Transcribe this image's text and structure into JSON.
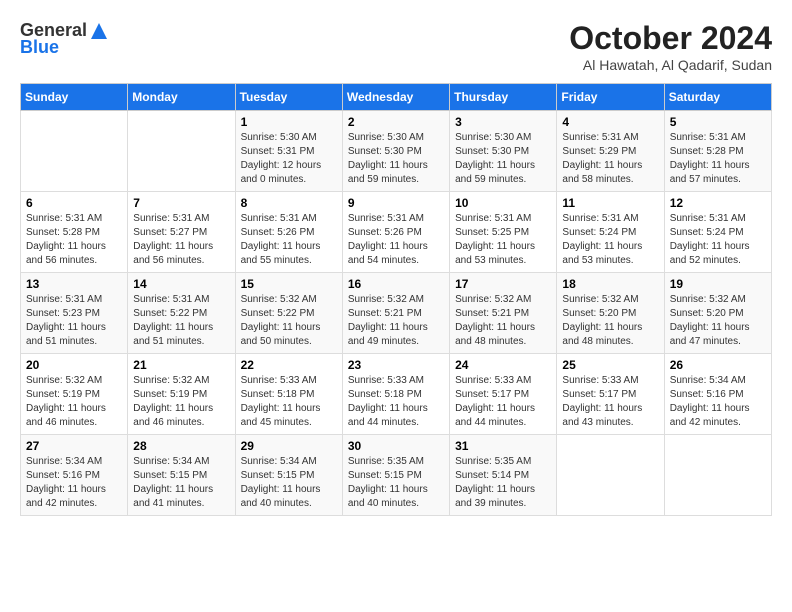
{
  "logo": {
    "general": "General",
    "blue": "Blue"
  },
  "title": "October 2024",
  "subtitle": "Al Hawatah, Al Qadarif, Sudan",
  "days_header": [
    "Sunday",
    "Monday",
    "Tuesday",
    "Wednesday",
    "Thursday",
    "Friday",
    "Saturday"
  ],
  "weeks": [
    [
      {
        "day": "",
        "info": ""
      },
      {
        "day": "",
        "info": ""
      },
      {
        "day": "1",
        "info": "Sunrise: 5:30 AM\nSunset: 5:31 PM\nDaylight: 12 hours and 0 minutes."
      },
      {
        "day": "2",
        "info": "Sunrise: 5:30 AM\nSunset: 5:30 PM\nDaylight: 11 hours and 59 minutes."
      },
      {
        "day": "3",
        "info": "Sunrise: 5:30 AM\nSunset: 5:30 PM\nDaylight: 11 hours and 59 minutes."
      },
      {
        "day": "4",
        "info": "Sunrise: 5:31 AM\nSunset: 5:29 PM\nDaylight: 11 hours and 58 minutes."
      },
      {
        "day": "5",
        "info": "Sunrise: 5:31 AM\nSunset: 5:28 PM\nDaylight: 11 hours and 57 minutes."
      }
    ],
    [
      {
        "day": "6",
        "info": "Sunrise: 5:31 AM\nSunset: 5:28 PM\nDaylight: 11 hours and 56 minutes."
      },
      {
        "day": "7",
        "info": "Sunrise: 5:31 AM\nSunset: 5:27 PM\nDaylight: 11 hours and 56 minutes."
      },
      {
        "day": "8",
        "info": "Sunrise: 5:31 AM\nSunset: 5:26 PM\nDaylight: 11 hours and 55 minutes."
      },
      {
        "day": "9",
        "info": "Sunrise: 5:31 AM\nSunset: 5:26 PM\nDaylight: 11 hours and 54 minutes."
      },
      {
        "day": "10",
        "info": "Sunrise: 5:31 AM\nSunset: 5:25 PM\nDaylight: 11 hours and 53 minutes."
      },
      {
        "day": "11",
        "info": "Sunrise: 5:31 AM\nSunset: 5:24 PM\nDaylight: 11 hours and 53 minutes."
      },
      {
        "day": "12",
        "info": "Sunrise: 5:31 AM\nSunset: 5:24 PM\nDaylight: 11 hours and 52 minutes."
      }
    ],
    [
      {
        "day": "13",
        "info": "Sunrise: 5:31 AM\nSunset: 5:23 PM\nDaylight: 11 hours and 51 minutes."
      },
      {
        "day": "14",
        "info": "Sunrise: 5:31 AM\nSunset: 5:22 PM\nDaylight: 11 hours and 51 minutes."
      },
      {
        "day": "15",
        "info": "Sunrise: 5:32 AM\nSunset: 5:22 PM\nDaylight: 11 hours and 50 minutes."
      },
      {
        "day": "16",
        "info": "Sunrise: 5:32 AM\nSunset: 5:21 PM\nDaylight: 11 hours and 49 minutes."
      },
      {
        "day": "17",
        "info": "Sunrise: 5:32 AM\nSunset: 5:21 PM\nDaylight: 11 hours and 48 minutes."
      },
      {
        "day": "18",
        "info": "Sunrise: 5:32 AM\nSunset: 5:20 PM\nDaylight: 11 hours and 48 minutes."
      },
      {
        "day": "19",
        "info": "Sunrise: 5:32 AM\nSunset: 5:20 PM\nDaylight: 11 hours and 47 minutes."
      }
    ],
    [
      {
        "day": "20",
        "info": "Sunrise: 5:32 AM\nSunset: 5:19 PM\nDaylight: 11 hours and 46 minutes."
      },
      {
        "day": "21",
        "info": "Sunrise: 5:32 AM\nSunset: 5:19 PM\nDaylight: 11 hours and 46 minutes."
      },
      {
        "day": "22",
        "info": "Sunrise: 5:33 AM\nSunset: 5:18 PM\nDaylight: 11 hours and 45 minutes."
      },
      {
        "day": "23",
        "info": "Sunrise: 5:33 AM\nSunset: 5:18 PM\nDaylight: 11 hours and 44 minutes."
      },
      {
        "day": "24",
        "info": "Sunrise: 5:33 AM\nSunset: 5:17 PM\nDaylight: 11 hours and 44 minutes."
      },
      {
        "day": "25",
        "info": "Sunrise: 5:33 AM\nSunset: 5:17 PM\nDaylight: 11 hours and 43 minutes."
      },
      {
        "day": "26",
        "info": "Sunrise: 5:34 AM\nSunset: 5:16 PM\nDaylight: 11 hours and 42 minutes."
      }
    ],
    [
      {
        "day": "27",
        "info": "Sunrise: 5:34 AM\nSunset: 5:16 PM\nDaylight: 11 hours and 42 minutes."
      },
      {
        "day": "28",
        "info": "Sunrise: 5:34 AM\nSunset: 5:15 PM\nDaylight: 11 hours and 41 minutes."
      },
      {
        "day": "29",
        "info": "Sunrise: 5:34 AM\nSunset: 5:15 PM\nDaylight: 11 hours and 40 minutes."
      },
      {
        "day": "30",
        "info": "Sunrise: 5:35 AM\nSunset: 5:15 PM\nDaylight: 11 hours and 40 minutes."
      },
      {
        "day": "31",
        "info": "Sunrise: 5:35 AM\nSunset: 5:14 PM\nDaylight: 11 hours and 39 minutes."
      },
      {
        "day": "",
        "info": ""
      },
      {
        "day": "",
        "info": ""
      }
    ]
  ]
}
